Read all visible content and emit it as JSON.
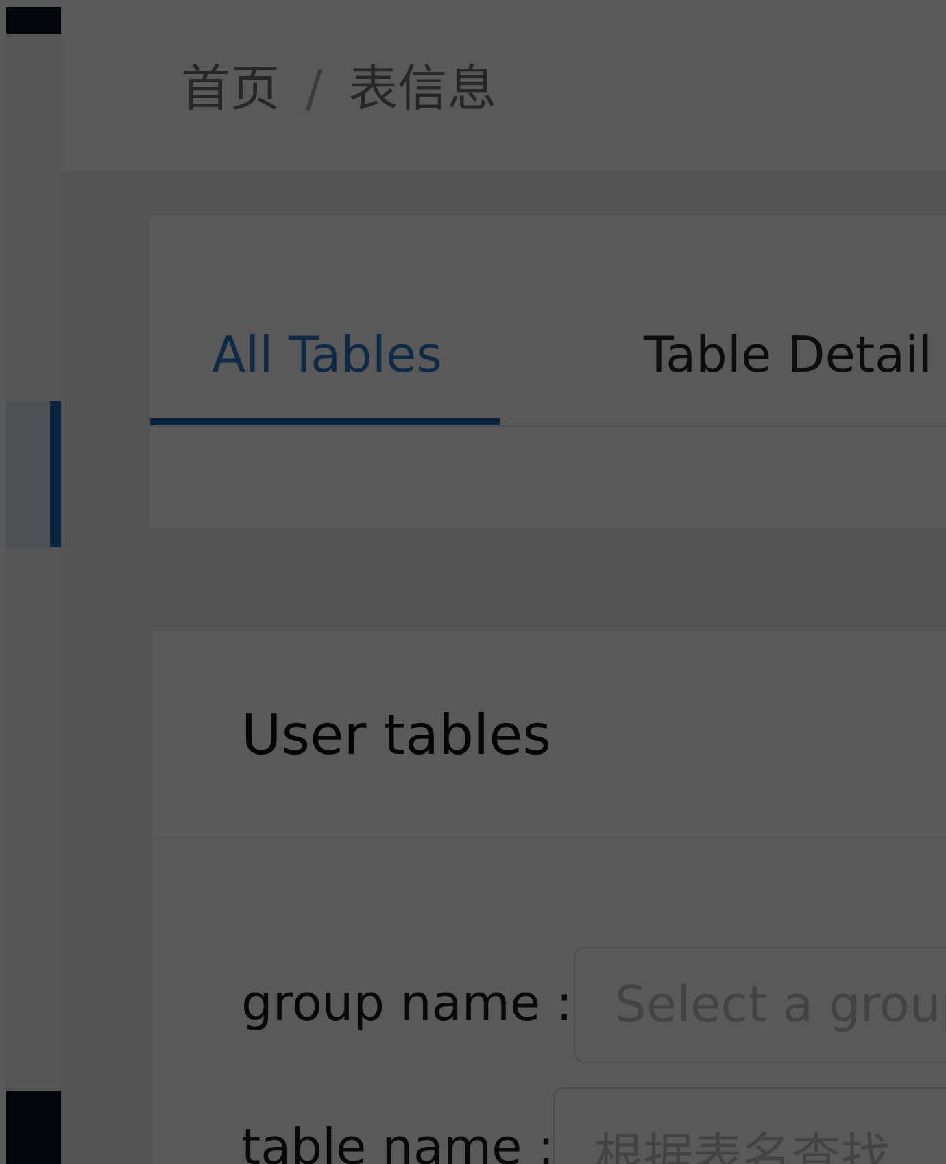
{
  "colors": {
    "accent": "#1f6bb8",
    "overlay": "rgba(0,0,0,0.65)",
    "sidebar_dark": "#0b1320"
  },
  "breadcrumb": {
    "home": "首页",
    "separator": "/",
    "current": "表信息"
  },
  "tabs": [
    {
      "label": "All Tables",
      "active": true
    },
    {
      "label": "Table Detail",
      "active": false
    }
  ],
  "card": {
    "title": "User tables"
  },
  "form": {
    "group_label": "group name :",
    "group_placeholder": "Select a group",
    "table_label": "table name :",
    "table_placeholder": "根据表名查找"
  }
}
